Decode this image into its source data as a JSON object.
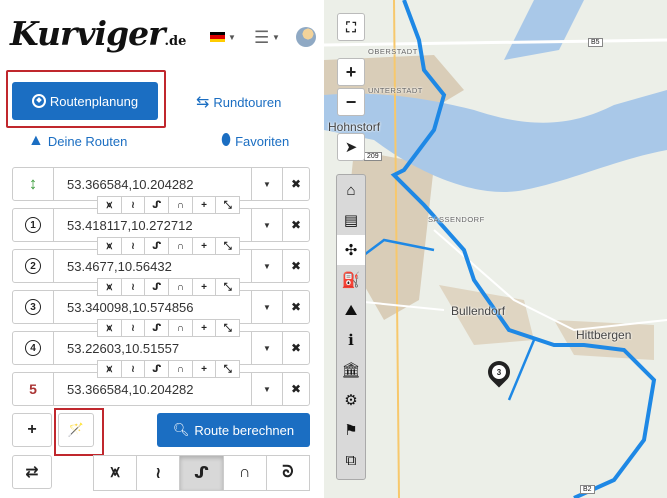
{
  "header": {
    "logo_main": "Kurviger",
    "logo_tld": ".de",
    "language_flag": "de-flag-icon",
    "menu_icon": "hamburger-icon",
    "avatar": "user-avatar"
  },
  "nav": {
    "route_planning": "Routenplanung",
    "round_trips": "Rundtouren",
    "your_routes": "Deine Routen",
    "favorites": "Favoriten"
  },
  "waypoints": [
    {
      "marker": "↕",
      "value": "53.366584,10.204282"
    },
    {
      "marker": "1",
      "value": "53.418117,10.272712"
    },
    {
      "marker": "2",
      "value": "53.4677,10.56432"
    },
    {
      "marker": "3",
      "value": "53.340098,10.574856"
    },
    {
      "marker": "4",
      "value": "53.22603,10.51557"
    },
    {
      "marker": "5",
      "value": "53.366584,10.204282"
    }
  ],
  "actions": {
    "add_label": "+",
    "calculate": "Route berechnen",
    "swap_label": "⇄"
  },
  "map": {
    "labels": {
      "hohnstorf": "Hohnstorf",
      "bullendorf": "Bullendorf",
      "hittbergen": "Hittbergen",
      "oberstadt": "OBERSTADT",
      "unterstadt": "UNTERSTADT",
      "sassendorf": "SASSENDORF"
    },
    "road_badges": {
      "b5": "B5",
      "r209": "209",
      "b2": "B2"
    },
    "marker_number": "3",
    "zoom_in": "+",
    "zoom_out": "−",
    "colors": {
      "water": "#a9c8e8",
      "route": "#1e88e5",
      "land": "#ecefe8"
    }
  }
}
